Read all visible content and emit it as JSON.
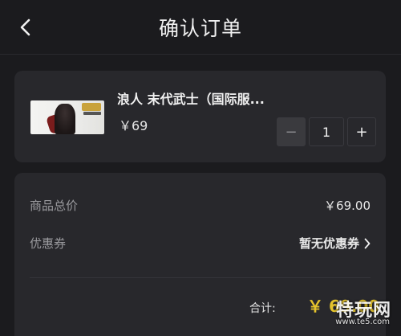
{
  "header": {
    "title": "确认订单",
    "back_icon": "chevron-left-icon"
  },
  "product": {
    "name": "浪人 末代武士（国际服...",
    "price": "￥69",
    "quantity": "1",
    "minus_label": "−",
    "plus_label": "+"
  },
  "summary": {
    "total_label": "商品总价",
    "total_value": "￥69.00",
    "coupon_label": "优惠券",
    "coupon_value": "暂无优惠券",
    "sum_label": "合计:",
    "sum_value": "￥ 69.00"
  },
  "watermark": {
    "text": "特玩网",
    "url": "www.te5.com"
  },
  "colors": {
    "background": "#1b1b1e",
    "card": "#28282c",
    "accent_price": "#e4c32c"
  }
}
